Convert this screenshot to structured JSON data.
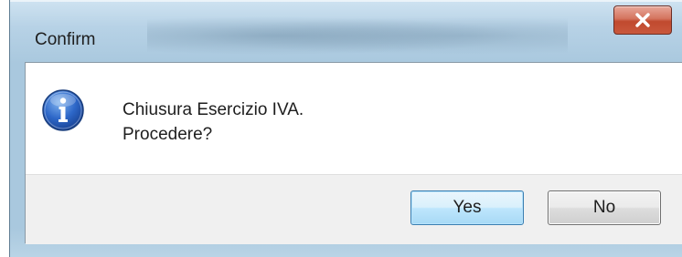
{
  "window": {
    "title": "Confirm",
    "close_icon": "close-icon"
  },
  "dialog": {
    "icon": "info-icon",
    "message_line1": "Chiusura Esercizio IVA.",
    "message_line2": "Procedere?"
  },
  "buttons": {
    "yes_label": "Yes",
    "no_label": "No"
  },
  "colors": {
    "accent": "#3c7fb1",
    "close": "#c04a2f",
    "frame": "#a9c8de"
  }
}
